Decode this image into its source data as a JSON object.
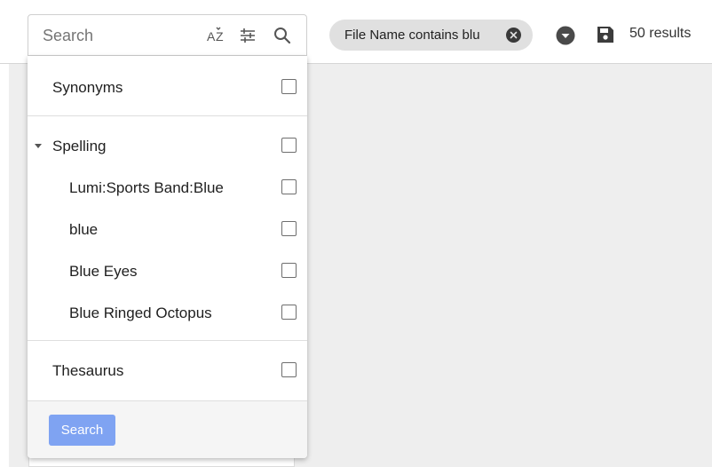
{
  "search": {
    "placeholder": "Search"
  },
  "toolbar_icons": [
    "sort-az-icon",
    "tune-icon",
    "search-icon"
  ],
  "dropdown": {
    "synonyms": {
      "label": "Synonyms"
    },
    "spelling": {
      "label": "Spelling",
      "items": [
        "Lumi:Sports Band:Blue",
        "blue",
        "Blue Eyes",
        "Blue Ringed Octopus"
      ]
    },
    "thesaurus": {
      "label": "Thesaurus"
    },
    "search_button": "Search"
  },
  "filter_chip": {
    "label": "File Name contains blu"
  },
  "results": {
    "count_text": "50 results"
  },
  "colors": {
    "primary_button": "#7fa3f2",
    "chip_bg": "#e0e0e0",
    "page_bg": "#eeeeee"
  }
}
